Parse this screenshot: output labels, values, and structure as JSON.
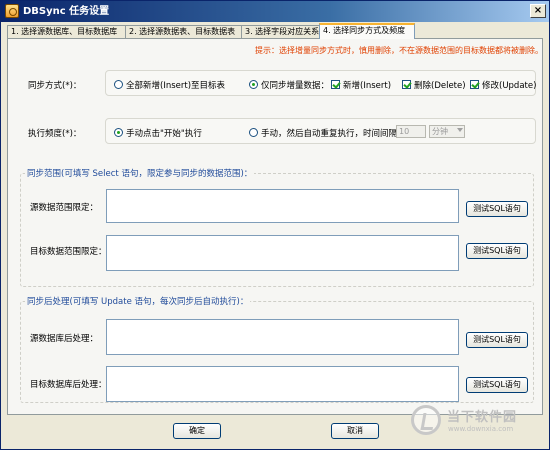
{
  "window": {
    "title": "DBSync 任务设置"
  },
  "tabs": [
    {
      "label": "1. 选择源数据库、目标数据库"
    },
    {
      "label": "2. 选择源数据表、目标数据表"
    },
    {
      "label": "3. 选择字段对应关系"
    },
    {
      "label": "4. 选择同步方式及频度",
      "active": true
    }
  ],
  "hint": "提示：选择增量同步方式时，慎用删除，不在源数据范围的目标数据都将被删除。",
  "sync_mode": {
    "label": "同步方式(*)：",
    "option_full": "全部新增(Insert)至目标表",
    "option_incremental": "仅同步增量数据：",
    "selected": "incremental",
    "checkboxes": {
      "insert": {
        "label": "新增(Insert)",
        "checked": true
      },
      "delete": {
        "label": "删除(Delete)",
        "checked": true
      },
      "update": {
        "label": "修改(Update)",
        "checked": true
      }
    }
  },
  "frequency": {
    "label": "执行频度(*)：",
    "option_manual": "手动点击\"开始\"执行",
    "option_repeat": "手动，然后自动重复执行，时间间隔：",
    "selected": "manual",
    "interval_value": "10",
    "interval_unit": "分钟"
  },
  "sync_range": {
    "title": "同步范围(可填写 Select 语句，限定参与同步的数据范围)：",
    "source_label": "源数据范围限定：",
    "target_label": "目标数据范围限定：",
    "test_button": "测试SQL语句"
  },
  "post_process": {
    "title": "同步后处理(可填写 Update 语句，每次同步后自动执行)：",
    "source_label": "源数据库后处理：",
    "target_label": "目标数据库后处理：",
    "test_button": "测试SQL语句"
  },
  "footer": {
    "ok": "确定",
    "cancel": "取消"
  },
  "watermark": {
    "text": "当下软件园",
    "url": "www.downxia.com"
  }
}
